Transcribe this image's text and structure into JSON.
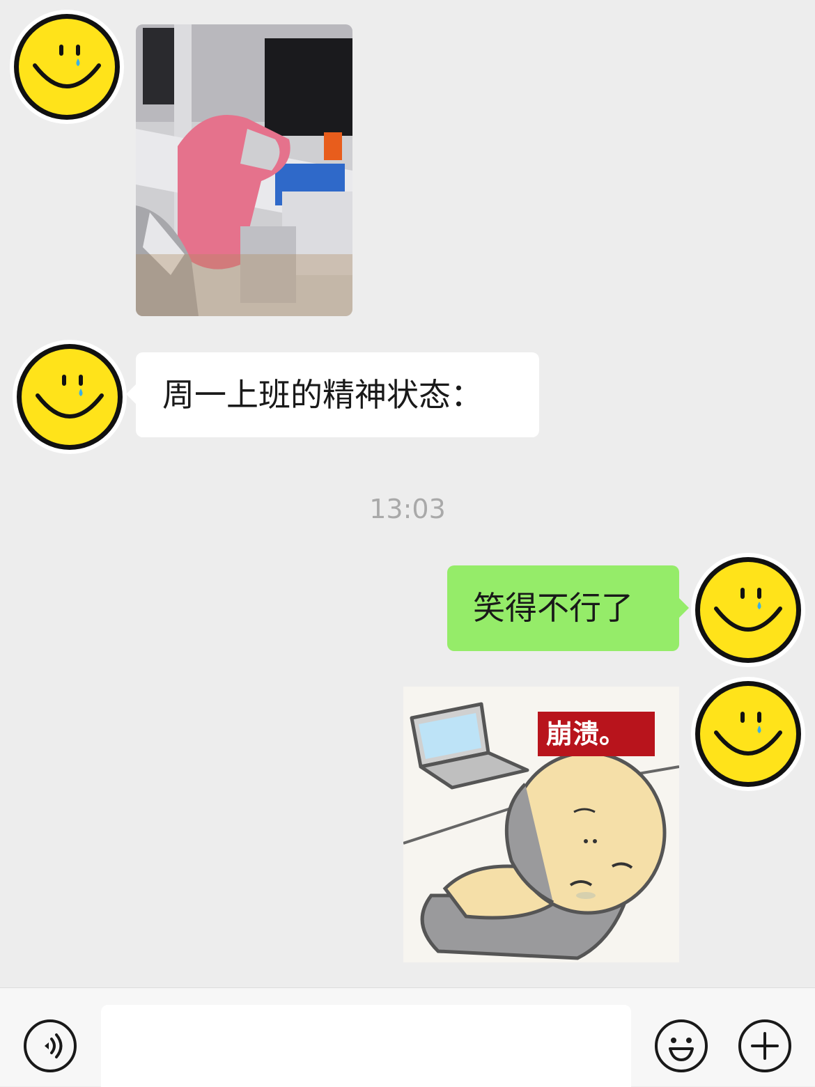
{
  "messages": [
    {
      "sender": "other",
      "type": "image",
      "content_description": "person sleeping at office desk in pink hoodie"
    },
    {
      "sender": "other",
      "type": "text",
      "text": "周一上班的精神状态："
    },
    {
      "sender": "me",
      "type": "text",
      "text": "笑得不行了"
    },
    {
      "sender": "me",
      "type": "sticker",
      "caption": "崩溃。"
    }
  ],
  "timestamp": "13:03",
  "input": {
    "value": "",
    "placeholder": ""
  },
  "icons": {
    "avatar": "smiley-face-with-tear-icon",
    "voice": "voice-icon",
    "emoji": "emoji-icon",
    "plus": "plus-icon"
  },
  "colors": {
    "background": "#ededed",
    "bubble_in": "#ffffff",
    "bubble_out": "#95ec69",
    "sticker_caption_bg": "#b8141c",
    "avatar_yellow": "#ffe31a"
  }
}
